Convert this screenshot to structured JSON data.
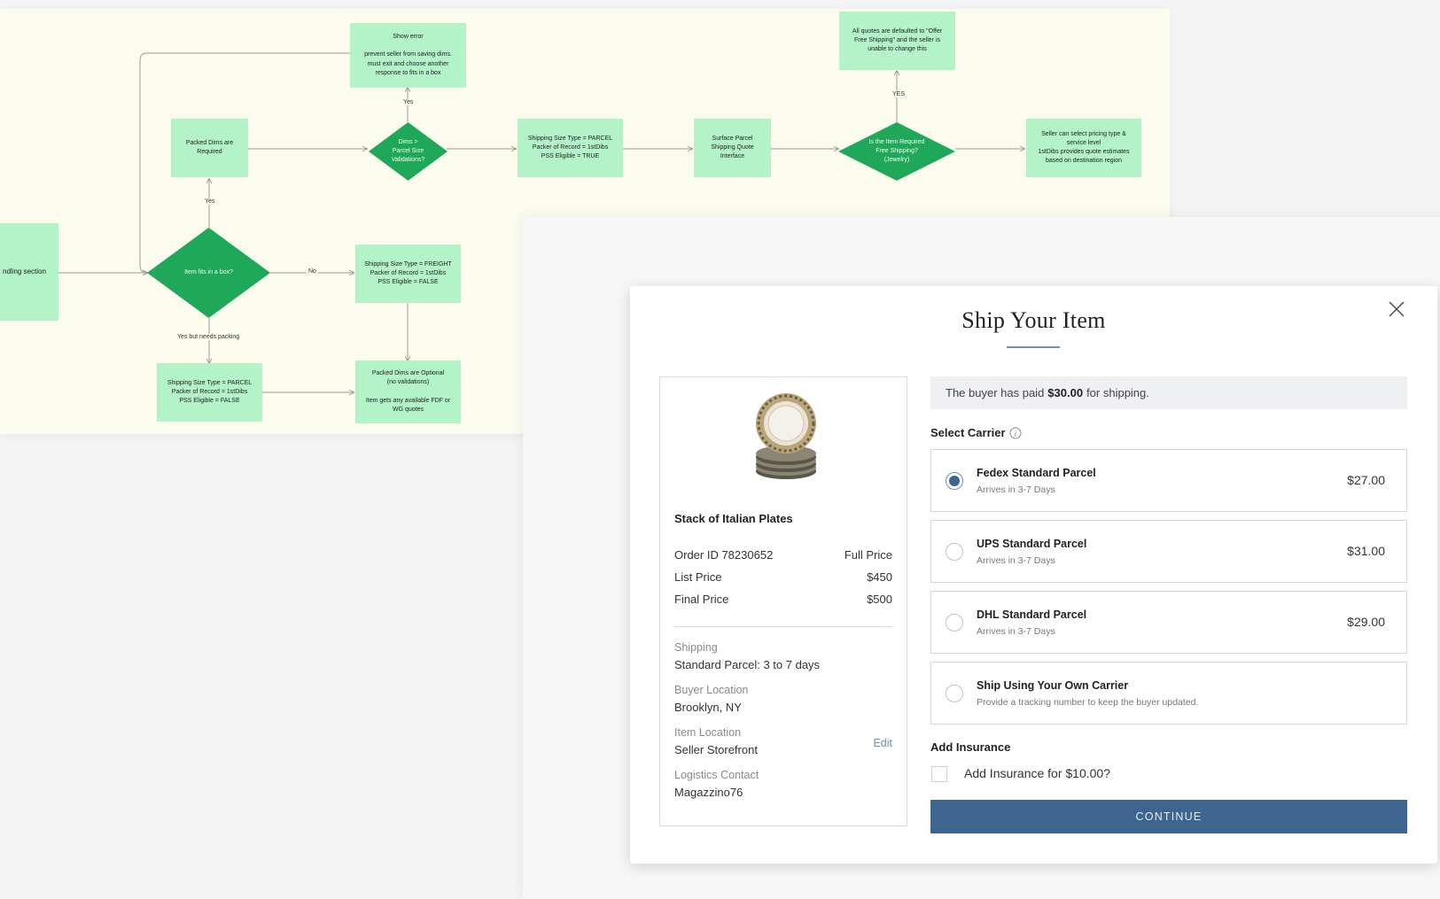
{
  "flowchart": {
    "nodes": {
      "handling_section": "ndling section",
      "fits_in_box": "Item fits in a box?",
      "packed_dims_required": "Packed Dims are\nRequired",
      "show_error": "Show error\n\nprevent seller from saving dims.\nmust exit and choose another\nresponse to fits in a box",
      "dims_validation": "Dims >\nParcel Size\nValidations?",
      "parcel_true": "Shipping Size Type = PARCEL\nPacker of Record = 1stDibs\nPSS Eligible = TRUE",
      "surface_quote": "Surface Parcel\nShipping Quote\nInterface",
      "free_shipping_q": "Is the Item Required\nFree Shipping?\n(Jewelry)",
      "quotes_defaulted": "All quotes are defaulted to \"Offer\nFree Shipping\" and the seller is\nunable to change this",
      "seller_select": "Seller can select pricing type &\nservice level\n1stDibs provides quote estimates\nbased on destination region",
      "freight": "Shipping Size Type = FREIGHT\nPacker of Record = 1stDibs\nPSS Eligible = FALSE",
      "parcel_false": "Shipping Size Type = PARCEL\nPacker of Record = 1stDibs\nPSS Eligible = FALSE",
      "dims_optional": "Packed Dims are Optional\n(no validations)\n\nItem gets any available FDF or\nWG quotes"
    },
    "edge_labels": {
      "yes_up": "Yes",
      "yes_error": "Yes",
      "yes_free": "YES",
      "no": "No",
      "yes_packing": "Yes but needs packing"
    }
  },
  "modal": {
    "title": "Ship Your Item",
    "close_icon": "close-icon",
    "summary": {
      "item_name": "Stack of Italian Plates",
      "order_id": "Order ID 78230652",
      "order_status": "Full Price",
      "list_price_label": "List Price",
      "list_price": "$450",
      "final_price_label": "Final Price",
      "final_price": "$500",
      "shipping_label": "Shipping",
      "shipping_value": "Standard Parcel: 3 to 7 days",
      "buyer_location_label": "Buyer Location",
      "buyer_location": "Brooklyn, NY",
      "item_location_label": "Item Location",
      "item_location": "Seller Storefront",
      "edit": "Edit",
      "logistics_label": "Logistics Contact",
      "logistics_value": "Magazzino76"
    },
    "banner": {
      "prefix": "The buyer has paid",
      "amount": "$30.00",
      "suffix": "for shipping."
    },
    "select_carrier": "Select Carrier",
    "carriers": [
      {
        "name": "Fedex Standard Parcel",
        "sub": "Arrives in 3-7 Days",
        "price": "$27.00",
        "selected": true
      },
      {
        "name": "UPS Standard Parcel",
        "sub": "Arrives in 3-7 Days",
        "price": "$31.00",
        "selected": false
      },
      {
        "name": "DHL Standard Parcel",
        "sub": "Arrives in 3-7 Days",
        "price": "$29.00",
        "selected": false
      },
      {
        "name": "Ship Using Your Own Carrier",
        "sub": "Provide a tracking number to keep the buyer updated.",
        "price": "",
        "selected": false
      }
    ],
    "add_insurance": "Add Insurance",
    "insurance_checkbox": "Add Insurance for $10.00?",
    "insurance_checked": false,
    "continue": "CONTINUE",
    "colors": {
      "primary": "#3e6490",
      "accent": "#6f8fb4",
      "flow_box": "#b2f3c8",
      "flow_diamond": "#1fa75a",
      "canvas": "#fcfcee"
    }
  }
}
